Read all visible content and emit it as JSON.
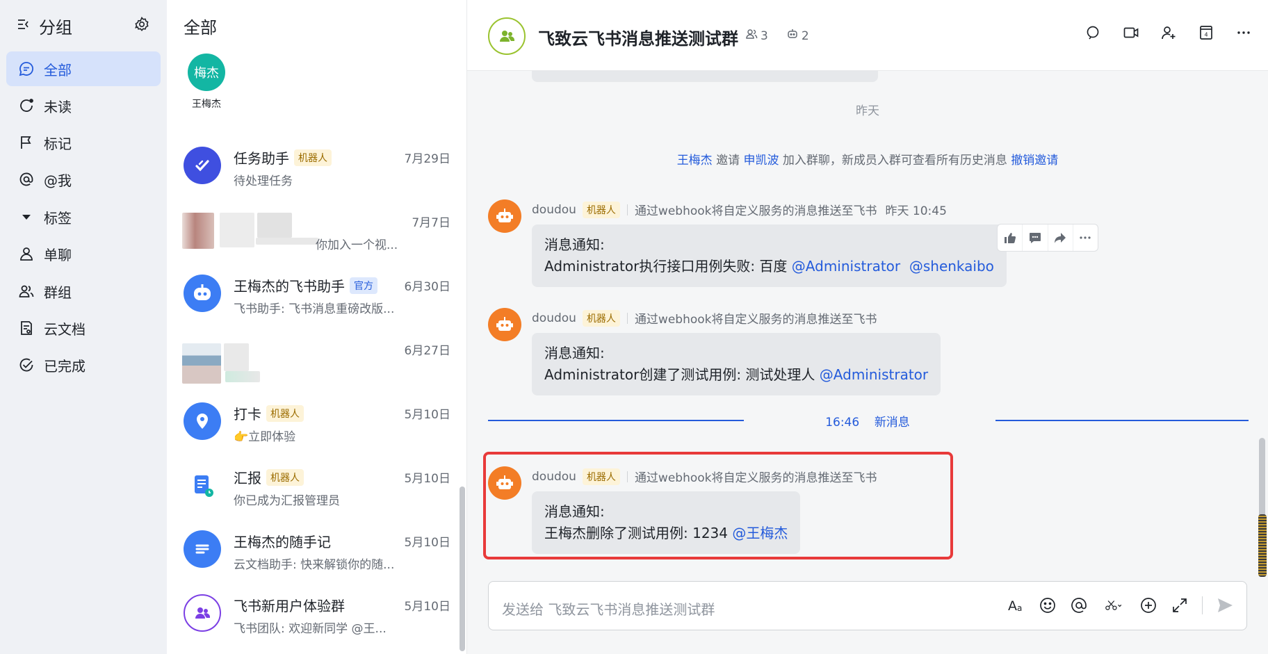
{
  "sidebar": {
    "title": "分组",
    "items": [
      {
        "label": "全部",
        "icon": "chat-bubble-icon",
        "active": true
      },
      {
        "label": "未读",
        "icon": "unread-circle-icon"
      },
      {
        "label": "标记",
        "icon": "flag-icon"
      },
      {
        "label": "@我",
        "icon": "at-icon"
      },
      {
        "label": "标签",
        "icon": "caret-down-icon"
      },
      {
        "label": "单聊",
        "icon": "person-icon"
      },
      {
        "label": "群组",
        "icon": "group-icon"
      },
      {
        "label": "云文档",
        "icon": "doc-icon"
      },
      {
        "label": "已完成",
        "icon": "check-circle-icon"
      }
    ]
  },
  "chatlist": {
    "title": "全部",
    "pinned": {
      "avatar_text": "梅杰",
      "name": "王梅杰"
    },
    "rows": [
      {
        "name": "任务助手",
        "tag": "机器人",
        "preview": "待处理任务",
        "date": "7月29日"
      },
      {
        "name": "",
        "tag": "",
        "preview": "你加入一个视...",
        "date": "7月7日"
      },
      {
        "name": "王梅杰的飞书助手",
        "tag": "官方",
        "preview": "飞书助手: 飞书消息重磅改版...",
        "date": "6月30日"
      },
      {
        "name": "",
        "tag": "",
        "preview": "",
        "date": "6月27日"
      },
      {
        "name": "打卡",
        "tag": "机器人",
        "preview": "👉立即体验",
        "date": "5月10日"
      },
      {
        "name": "汇报",
        "tag": "机器人",
        "preview": "你已成为汇报管理员",
        "date": "5月10日"
      },
      {
        "name": "王梅杰的随手记",
        "tag": "",
        "preview": "云文档助手: 快来解锁你的随...",
        "date": "5月10日"
      },
      {
        "name": "飞书新用户体验群",
        "tag": "",
        "preview": "飞书团队: 欢迎新同学 @王...",
        "date": "5月10日"
      }
    ]
  },
  "conversation": {
    "group_name": "飞致云飞书消息推送测试群",
    "member_count": "3",
    "bot_count": "2",
    "day_separator": "昨天",
    "system_message": {
      "inviter": "王梅杰",
      "verb": "邀请",
      "invitee": "申凯波",
      "text": "加入群聊，新成员入群可查看所有历史消息",
      "action": "撤销邀请"
    },
    "messages": [
      {
        "sender": "doudou",
        "tag": "机器人",
        "description": "通过webhook将自定义服务的消息推送至飞书",
        "time": "昨天 10:45",
        "line1": "消息通知:",
        "line2": "Administrator执行接口用例失败: 百度",
        "mentions": [
          "@Administrator",
          "@shenkaibo"
        ]
      },
      {
        "sender": "doudou",
        "tag": "机器人",
        "description": "通过webhook将自定义服务的消息推送至飞书",
        "time": "",
        "line1": "消息通知:",
        "line2": "Administrator创建了测试用例: 测试处理人",
        "mentions": [
          "@Administrator"
        ]
      },
      {
        "sender": "doudou",
        "tag": "机器人",
        "description": "通过webhook将自定义服务的消息推送至飞书",
        "time": "",
        "line1": "消息通知:",
        "line2": "王梅杰删除了测试用例: 1234",
        "mentions": [
          "@王梅杰"
        ]
      }
    ],
    "new_divider": {
      "time": "16:46",
      "label": "新消息"
    },
    "composer_placeholder": "发送给 飞致云飞书消息推送测试群"
  },
  "colors": {
    "accent": "#245bdb",
    "highlight": "#e83a3a",
    "bot_avatar": "#f37d26",
    "bot_tag_bg": "#fdf3d8"
  }
}
